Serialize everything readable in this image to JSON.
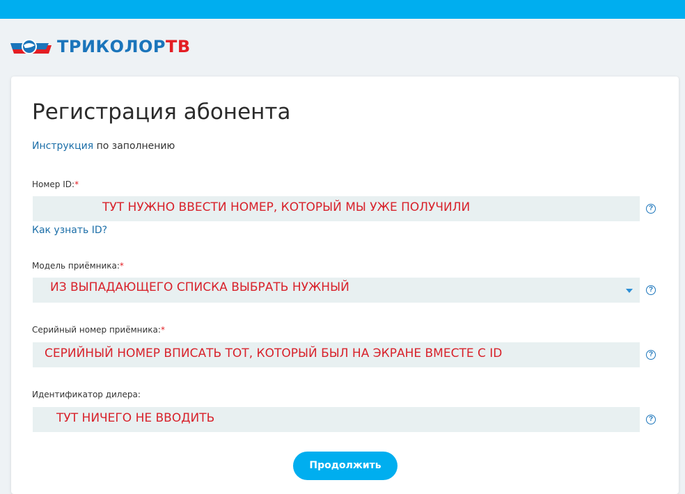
{
  "brand": {
    "name_part1": "ТРИКОЛОР",
    "name_part2": "ТВ"
  },
  "page": {
    "title": "Регистрация абонента"
  },
  "instruction": {
    "link_text": "Инструкция",
    "rest_text": " по заполнению"
  },
  "fields": {
    "id": {
      "label": "Номер ID:",
      "required_mark": "*",
      "hint": "ТУТ НУЖНО ВВЕСТИ НОМЕР, КОТОРЫЙ МЫ УЖЕ ПОЛУЧИЛИ",
      "help_link": "Как узнать ID?"
    },
    "model": {
      "label": "Модель приёмника:",
      "required_mark": "*",
      "hint": "ИЗ ВЫПАДАЮЩЕГО СПИСКА ВЫБРАТЬ НУЖНЫЙ"
    },
    "serial": {
      "label": "Серийный номер приёмника:",
      "required_mark": "*",
      "hint": "СЕРИЙНЫЙ НОМЕР ВПИСАТЬ ТОТ, КОТОРЫЙ БЫЛ НА ЭКРАНЕ ВМЕСТЕ С ID"
    },
    "dealer": {
      "label": "Идентификатор дилера:",
      "hint": "ТУТ НИЧЕГО НЕ ВВОДИТЬ"
    }
  },
  "help_glyph": "?",
  "submit": {
    "label": "Продолжить"
  },
  "colors": {
    "accent": "#00aeef",
    "brand_blue": "#1b75bb",
    "annotation_red": "#d8222b",
    "field_bg": "#e8f0f1"
  }
}
